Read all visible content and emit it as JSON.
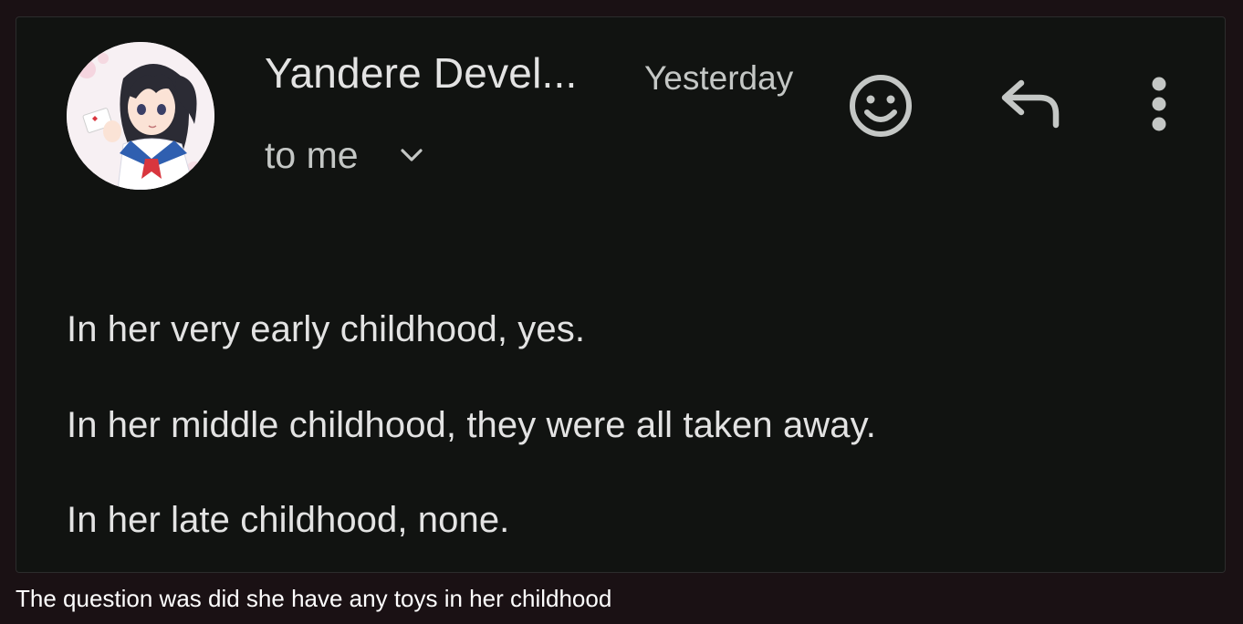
{
  "email": {
    "sender": "Yandere Devel...",
    "time": "Yesterday",
    "recipient": "to me",
    "body_lines": [
      "In her very early childhood, yes.",
      "In her middle childhood, they were all taken away.",
      "In her late childhood, none."
    ],
    "icons": {
      "avatar": "anime-girl-avatar",
      "expand_recipients": "chevron-down-icon",
      "react": "emoji-icon",
      "reply": "reply-icon",
      "more": "more-vert-icon"
    },
    "colors": {
      "background": "#111311",
      "primary_text": "#e3e3e3",
      "secondary_text": "#c4c7c5"
    }
  },
  "caption": "The question was did she have any toys in her childhood",
  "page": {
    "background": "#1a1114"
  }
}
